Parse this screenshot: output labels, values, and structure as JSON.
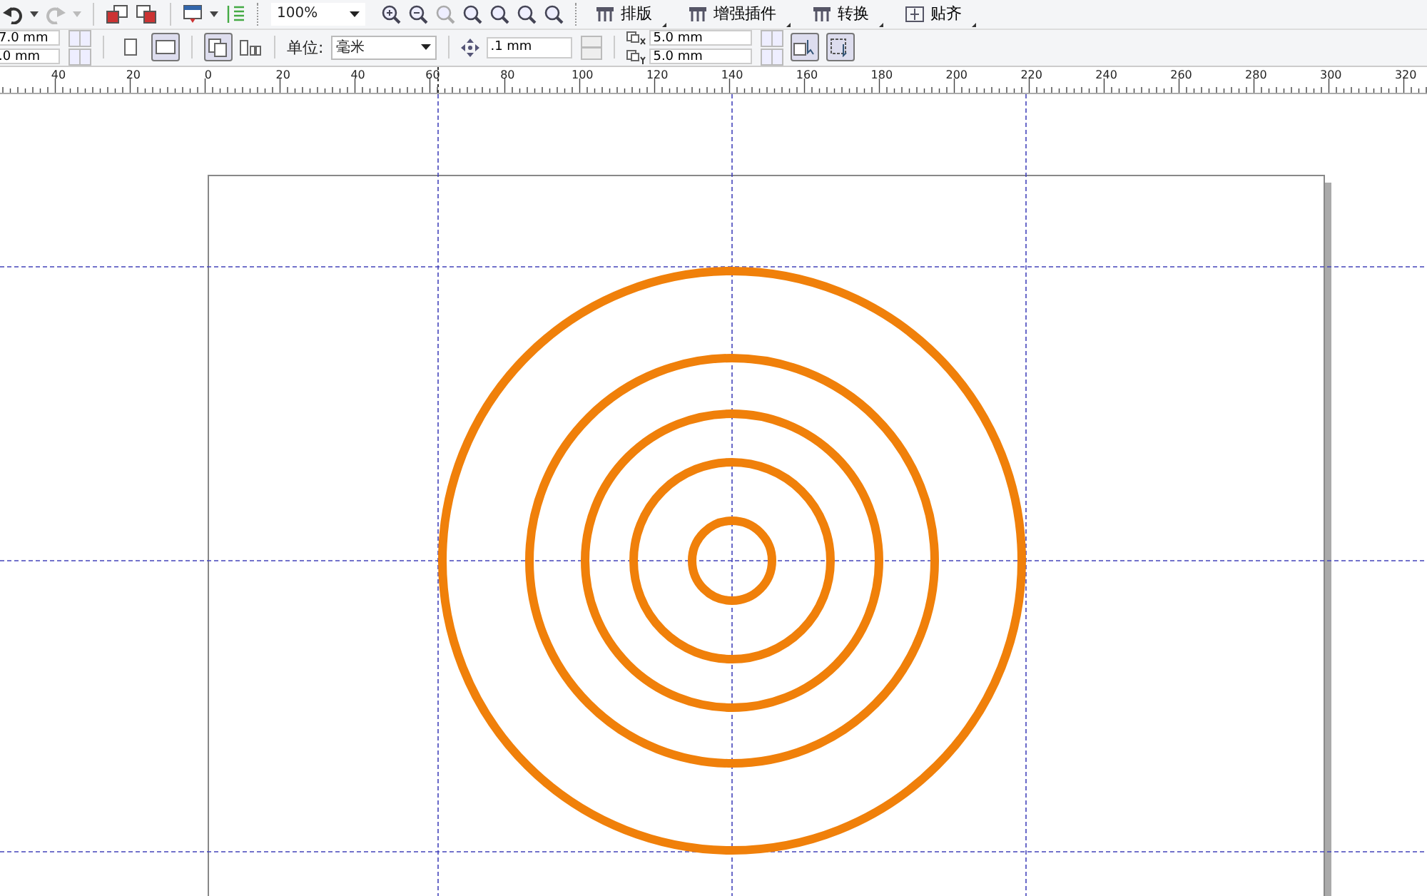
{
  "toolbar": {
    "zoom": "100%",
    "menus": [
      "排版",
      "增强插件",
      "转换",
      "贴齐"
    ]
  },
  "property_bar": {
    "width": "7.0 mm",
    "height": ".0 mm",
    "orientation": [
      {
        "kind": "portrait",
        "selected": false
      },
      {
        "kind": "landscape",
        "selected": true
      }
    ],
    "unit_label": "单位:",
    "unit": "毫米",
    "nudge": ".1 mm",
    "duplicate_x": "5.0 mm",
    "duplicate_y": "5.0 mm"
  },
  "ruler": {
    "labels": [
      "40",
      "20",
      "0",
      "20",
      "40",
      "60",
      "80",
      "100",
      "120",
      "140",
      "160",
      "180",
      "200",
      "220",
      "240",
      "260",
      "280",
      "300",
      "320"
    ]
  }
}
